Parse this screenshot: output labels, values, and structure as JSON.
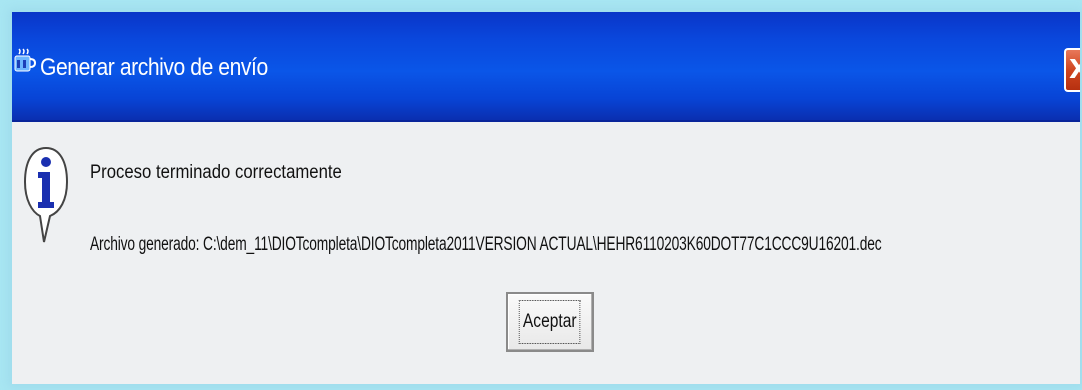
{
  "window": {
    "title": "Generar archivo de envío",
    "title_icon": "java-cup-icon",
    "close_label": "X"
  },
  "message": {
    "icon": "info-icon",
    "line1": "Proceso terminado correctamente",
    "line2": "Archivo generado: C:\\dem_11\\DIOTcompleta\\DIOTcompleta2011VERSION ACTUAL\\HEHR6110203K60DOT77C1CCC9U16201.dec"
  },
  "buttons": {
    "accept_label": "Aceptar"
  },
  "colors": {
    "titlebar": "#0a56e8",
    "close": "#d0451f",
    "background": "#a8e6f2"
  }
}
